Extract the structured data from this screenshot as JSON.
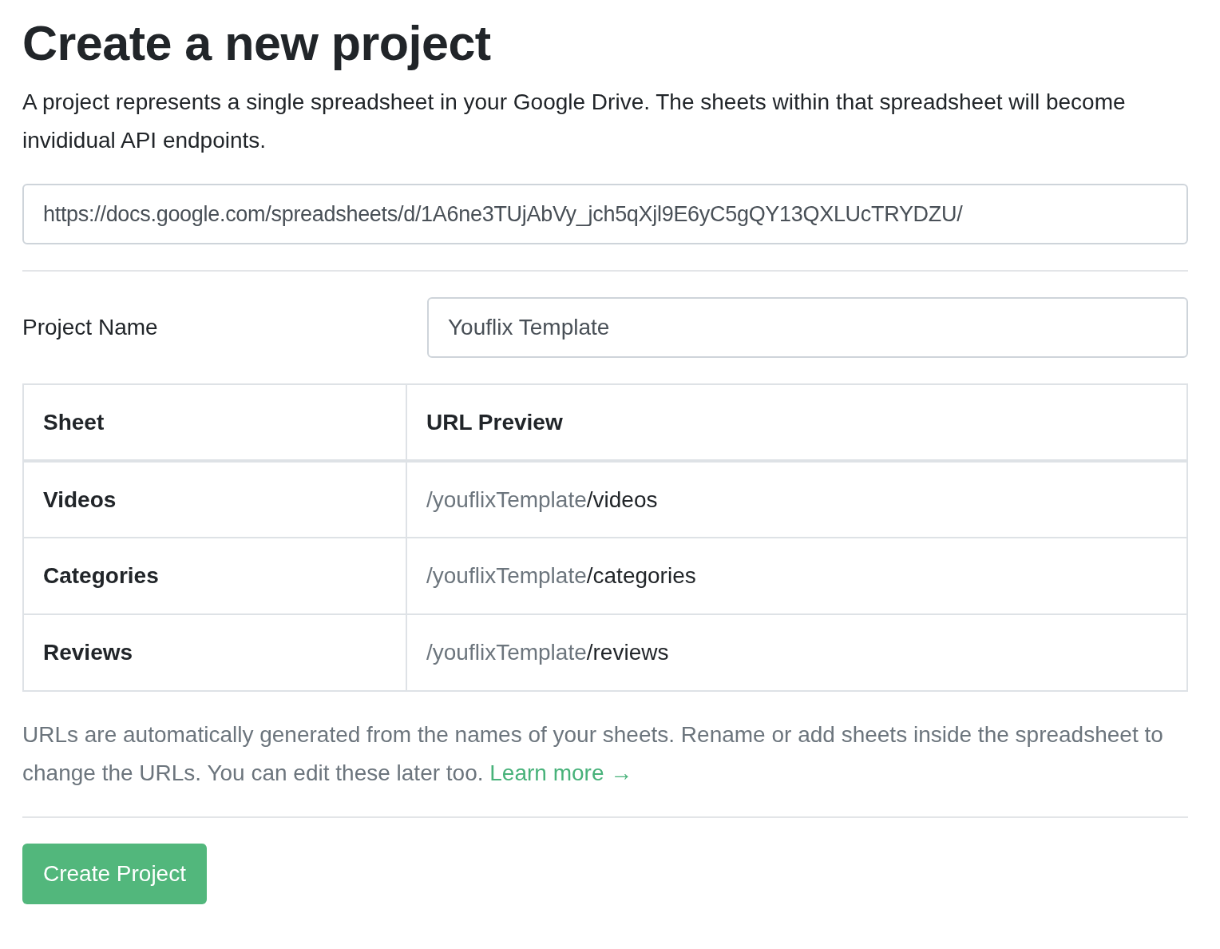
{
  "title": "Create a new project",
  "description": "A project represents a single spreadsheet in your Google Drive. The sheets within that spreadsheet will become invididual API endpoints.",
  "spreadsheet_url": {
    "value": "https://docs.google.com/spreadsheets/d/1A6ne3TUjAbVy_jch5qXjl9E6yC5gQY13QXLUcTRYDZU/"
  },
  "project_name": {
    "label": "Project Name",
    "value": "Youflix Template"
  },
  "table": {
    "columns": [
      "Sheet",
      "URL Preview"
    ],
    "rows": [
      {
        "sheet": "Videos",
        "url_prefix": "/youflixTemplate",
        "url_path": "/videos"
      },
      {
        "sheet": "Categories",
        "url_prefix": "/youflixTemplate",
        "url_path": "/categories"
      },
      {
        "sheet": "Reviews",
        "url_prefix": "/youflixTemplate",
        "url_path": "/reviews"
      }
    ]
  },
  "help": {
    "text": "URLs are automatically generated from the names of your sheets. Rename or add sheets inside the spreadsheet to change the URLs. You can edit these later too.",
    "link": "Learn more →"
  },
  "buttons": [
    "Create Project"
  ]
}
